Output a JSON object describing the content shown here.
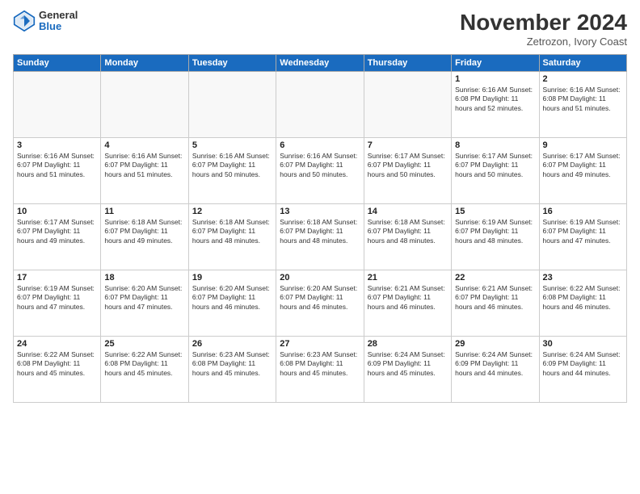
{
  "header": {
    "logo_general": "General",
    "logo_blue": "Blue",
    "month_title": "November 2024",
    "subtitle": "Zetrozon, Ivory Coast"
  },
  "days_of_week": [
    "Sunday",
    "Monday",
    "Tuesday",
    "Wednesday",
    "Thursday",
    "Friday",
    "Saturday"
  ],
  "weeks": [
    [
      {
        "day": "",
        "info": ""
      },
      {
        "day": "",
        "info": ""
      },
      {
        "day": "",
        "info": ""
      },
      {
        "day": "",
        "info": ""
      },
      {
        "day": "",
        "info": ""
      },
      {
        "day": "1",
        "info": "Sunrise: 6:16 AM\nSunset: 6:08 PM\nDaylight: 11 hours\nand 52 minutes."
      },
      {
        "day": "2",
        "info": "Sunrise: 6:16 AM\nSunset: 6:08 PM\nDaylight: 11 hours\nand 51 minutes."
      }
    ],
    [
      {
        "day": "3",
        "info": "Sunrise: 6:16 AM\nSunset: 6:07 PM\nDaylight: 11 hours\nand 51 minutes."
      },
      {
        "day": "4",
        "info": "Sunrise: 6:16 AM\nSunset: 6:07 PM\nDaylight: 11 hours\nand 51 minutes."
      },
      {
        "day": "5",
        "info": "Sunrise: 6:16 AM\nSunset: 6:07 PM\nDaylight: 11 hours\nand 50 minutes."
      },
      {
        "day": "6",
        "info": "Sunrise: 6:16 AM\nSunset: 6:07 PM\nDaylight: 11 hours\nand 50 minutes."
      },
      {
        "day": "7",
        "info": "Sunrise: 6:17 AM\nSunset: 6:07 PM\nDaylight: 11 hours\nand 50 minutes."
      },
      {
        "day": "8",
        "info": "Sunrise: 6:17 AM\nSunset: 6:07 PM\nDaylight: 11 hours\nand 50 minutes."
      },
      {
        "day": "9",
        "info": "Sunrise: 6:17 AM\nSunset: 6:07 PM\nDaylight: 11 hours\nand 49 minutes."
      }
    ],
    [
      {
        "day": "10",
        "info": "Sunrise: 6:17 AM\nSunset: 6:07 PM\nDaylight: 11 hours\nand 49 minutes."
      },
      {
        "day": "11",
        "info": "Sunrise: 6:18 AM\nSunset: 6:07 PM\nDaylight: 11 hours\nand 49 minutes."
      },
      {
        "day": "12",
        "info": "Sunrise: 6:18 AM\nSunset: 6:07 PM\nDaylight: 11 hours\nand 48 minutes."
      },
      {
        "day": "13",
        "info": "Sunrise: 6:18 AM\nSunset: 6:07 PM\nDaylight: 11 hours\nand 48 minutes."
      },
      {
        "day": "14",
        "info": "Sunrise: 6:18 AM\nSunset: 6:07 PM\nDaylight: 11 hours\nand 48 minutes."
      },
      {
        "day": "15",
        "info": "Sunrise: 6:19 AM\nSunset: 6:07 PM\nDaylight: 11 hours\nand 48 minutes."
      },
      {
        "day": "16",
        "info": "Sunrise: 6:19 AM\nSunset: 6:07 PM\nDaylight: 11 hours\nand 47 minutes."
      }
    ],
    [
      {
        "day": "17",
        "info": "Sunrise: 6:19 AM\nSunset: 6:07 PM\nDaylight: 11 hours\nand 47 minutes."
      },
      {
        "day": "18",
        "info": "Sunrise: 6:20 AM\nSunset: 6:07 PM\nDaylight: 11 hours\nand 47 minutes."
      },
      {
        "day": "19",
        "info": "Sunrise: 6:20 AM\nSunset: 6:07 PM\nDaylight: 11 hours\nand 46 minutes."
      },
      {
        "day": "20",
        "info": "Sunrise: 6:20 AM\nSunset: 6:07 PM\nDaylight: 11 hours\nand 46 minutes."
      },
      {
        "day": "21",
        "info": "Sunrise: 6:21 AM\nSunset: 6:07 PM\nDaylight: 11 hours\nand 46 minutes."
      },
      {
        "day": "22",
        "info": "Sunrise: 6:21 AM\nSunset: 6:07 PM\nDaylight: 11 hours\nand 46 minutes."
      },
      {
        "day": "23",
        "info": "Sunrise: 6:22 AM\nSunset: 6:08 PM\nDaylight: 11 hours\nand 46 minutes."
      }
    ],
    [
      {
        "day": "24",
        "info": "Sunrise: 6:22 AM\nSunset: 6:08 PM\nDaylight: 11 hours\nand 45 minutes."
      },
      {
        "day": "25",
        "info": "Sunrise: 6:22 AM\nSunset: 6:08 PM\nDaylight: 11 hours\nand 45 minutes."
      },
      {
        "day": "26",
        "info": "Sunrise: 6:23 AM\nSunset: 6:08 PM\nDaylight: 11 hours\nand 45 minutes."
      },
      {
        "day": "27",
        "info": "Sunrise: 6:23 AM\nSunset: 6:08 PM\nDaylight: 11 hours\nand 45 minutes."
      },
      {
        "day": "28",
        "info": "Sunrise: 6:24 AM\nSunset: 6:09 PM\nDaylight: 11 hours\nand 45 minutes."
      },
      {
        "day": "29",
        "info": "Sunrise: 6:24 AM\nSunset: 6:09 PM\nDaylight: 11 hours\nand 44 minutes."
      },
      {
        "day": "30",
        "info": "Sunrise: 6:24 AM\nSunset: 6:09 PM\nDaylight: 11 hours\nand 44 minutes."
      }
    ]
  ]
}
